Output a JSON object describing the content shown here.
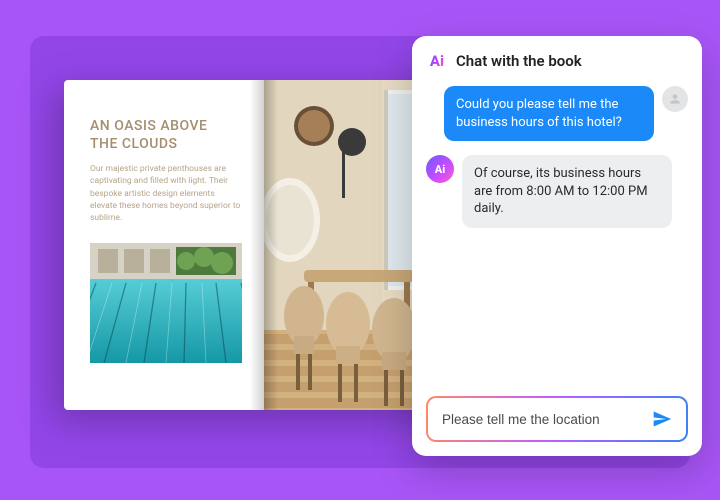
{
  "book": {
    "title_line1": "AN OASIS ABOVE",
    "title_line2": "THE CLOUDS",
    "body": "Our majestic private penthouses are captivating and filled with light. Their bespoke artistic design elements elevate these homes beyond superior to sublime."
  },
  "chat": {
    "title": "Chat with the book",
    "user_message": "Could you please tell me the business hours of this hotel?",
    "ai_message": "Of course, its business hours are from 8:00 AM to 12:00 PM daily.",
    "input_value": "Please tell me the location"
  },
  "icons": {
    "logo": "Ai",
    "send": "send-icon",
    "user": "person-icon",
    "ai_badge": "Ai"
  },
  "colors": {
    "bg": "#a855f7",
    "panel": "#9246e8",
    "user_bubble": "#1b8af8",
    "ai_bubble": "#edeef0"
  }
}
